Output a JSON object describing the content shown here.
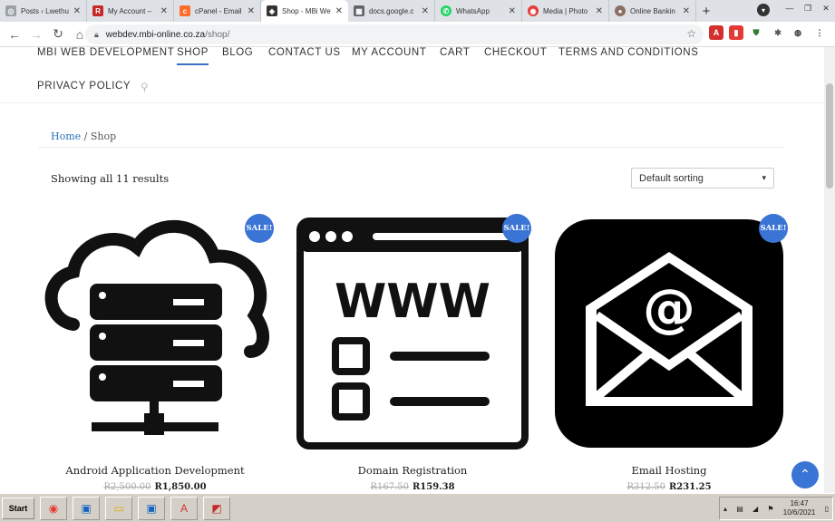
{
  "browser": {
    "tabs": [
      {
        "label": "Posts ‹ Lwethu",
        "icon_color": "#9aa0a6",
        "icon_glyph": "◎"
      },
      {
        "label": "My Account –",
        "icon_color": "#c62828",
        "icon_glyph": "R"
      },
      {
        "label": "cPanel - Email",
        "icon_color": "#ff6c2c",
        "icon_glyph": "c"
      },
      {
        "label": "Shop - MBi We",
        "icon_color": "#333333",
        "icon_glyph": "◈"
      },
      {
        "label": "docs.google.c",
        "icon_color": "#5f6368",
        "icon_glyph": "▦"
      },
      {
        "label": "WhatsApp",
        "icon_color": "#25d366",
        "icon_glyph": "✆"
      },
      {
        "label": "Media | Photo",
        "icon_color": "#e53935",
        "icon_glyph": "◉"
      },
      {
        "label": "Online Bankin",
        "icon_color": "#8d6e63",
        "icon_glyph": "●"
      }
    ],
    "close_glyph": "✕",
    "newtab_glyph": "+",
    "url_host": "webdev.mbi-online.co.za",
    "url_path": "/shop/"
  },
  "nav": {
    "items": [
      "MBI WEB DEVELOPMENT",
      "SHOP",
      "BLOG",
      "CONTACT US",
      "MY ACCOUNT",
      "CART",
      "CHECKOUT",
      "TERMS AND CONDITIONS",
      "PRIVACY POLICY"
    ],
    "search_glyph": "⚲"
  },
  "breadcrumb": {
    "home": "Home",
    "separator": " / ",
    "current": "Shop"
  },
  "shop": {
    "results": "Showing all 11 results",
    "sorting": "Default sorting",
    "sale_label": "SALE!",
    "products": [
      {
        "title": "Android Application Development",
        "old_price": "R2,500.00",
        "price": "R1,850.00"
      },
      {
        "title": "Domain Registration",
        "old_price": "R167.50",
        "price": "R159.38"
      },
      {
        "title": "Email Hosting",
        "old_price": "R312.50",
        "price": "R231.25"
      }
    ]
  },
  "taskbar": {
    "start": "Start",
    "time": "16:47",
    "date": "10/6/2021"
  },
  "colors": {
    "accent": "#3a74d4",
    "link": "#2a6fb8"
  }
}
